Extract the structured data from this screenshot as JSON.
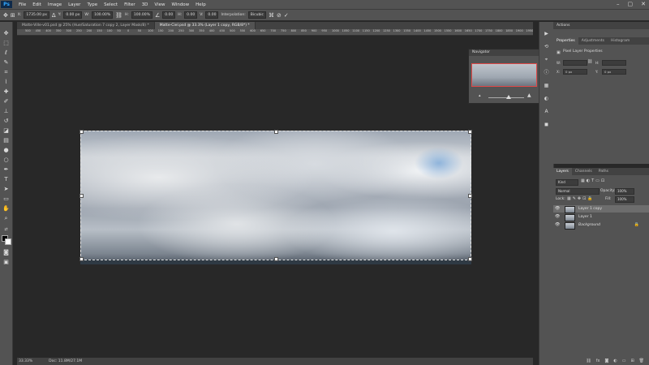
{
  "menubar": {
    "app_logo": "Ps",
    "items": [
      "File",
      "Edit",
      "Image",
      "Layer",
      "Type",
      "Select",
      "Filter",
      "3D",
      "View",
      "Window",
      "Help"
    ],
    "window_controls": [
      "–",
      "▢",
      "✕"
    ]
  },
  "options": {
    "x_label": "X:",
    "x_value": "1735.00 px",
    "y_label": "Y:",
    "y_value": "0.00 px",
    "w_label": "W:",
    "w_value": "100.00%",
    "h_label": "H:",
    "h_value": "100.00%",
    "angle_value": "0.00",
    "hskew_label": "H:",
    "hskew_value": "0.00",
    "vskew_label": "V:",
    "vskew_value": "0.00",
    "interp_label": "Interpolation:",
    "interp_value": "Bicubic"
  },
  "tabs": [
    "Matte-Ville-v01.psd @ 25% (Hue/Saturation 7 copy 2, Layer Mask/8) *",
    "Matte-Ciel.psd @ 33.3% (Layer 1 copy, RGB/8*) *"
  ],
  "ruler": [
    "500",
    "450",
    "400",
    "350",
    "300",
    "250",
    "200",
    "150",
    "100",
    "50",
    "0",
    "50",
    "100",
    "150",
    "200",
    "250",
    "300",
    "350",
    "400",
    "450",
    "500",
    "550",
    "600",
    "650",
    "700",
    "750",
    "800",
    "850",
    "900",
    "950",
    "1000",
    "1050",
    "1100",
    "1150",
    "1200",
    "1250",
    "1300",
    "1350",
    "1400",
    "1450",
    "1500",
    "1550",
    "1600",
    "1650",
    "1700",
    "1750",
    "1800",
    "1850",
    "1900",
    "1950",
    "2000"
  ],
  "status": {
    "zoom": "33.33%",
    "doc": "Doc: 11.8M/27.1M"
  },
  "navigator": {
    "title": "Navigator"
  },
  "actions": {
    "title": "Actions"
  },
  "properties": {
    "tabs": [
      "Properties",
      "Adjustments",
      "Histogram"
    ],
    "subtitle": "Pixel Layer Properties",
    "w_label": "W:",
    "h_label": "H:",
    "x_label": "X:",
    "x_value": "0 px",
    "y_label": "Y:",
    "y_value": "0 px"
  },
  "layers": {
    "tabs": [
      "Layers",
      "Channels",
      "Paths"
    ],
    "search_placeholder": "Kind",
    "blend_mode": "Normal",
    "opacity_label": "Opacity:",
    "opacity_value": "100%",
    "lock_label": "Lock:",
    "fill_label": "Fill:",
    "fill_value": "100%",
    "items": [
      {
        "name": "Layer 1 copy",
        "selected": true
      },
      {
        "name": "Layer 1",
        "selected": false
      },
      {
        "name": "Background",
        "selected": false
      }
    ]
  },
  "colors": {
    "accent": "#31a8ff",
    "panel": "#535353",
    "canvas_bg": "#282828"
  }
}
